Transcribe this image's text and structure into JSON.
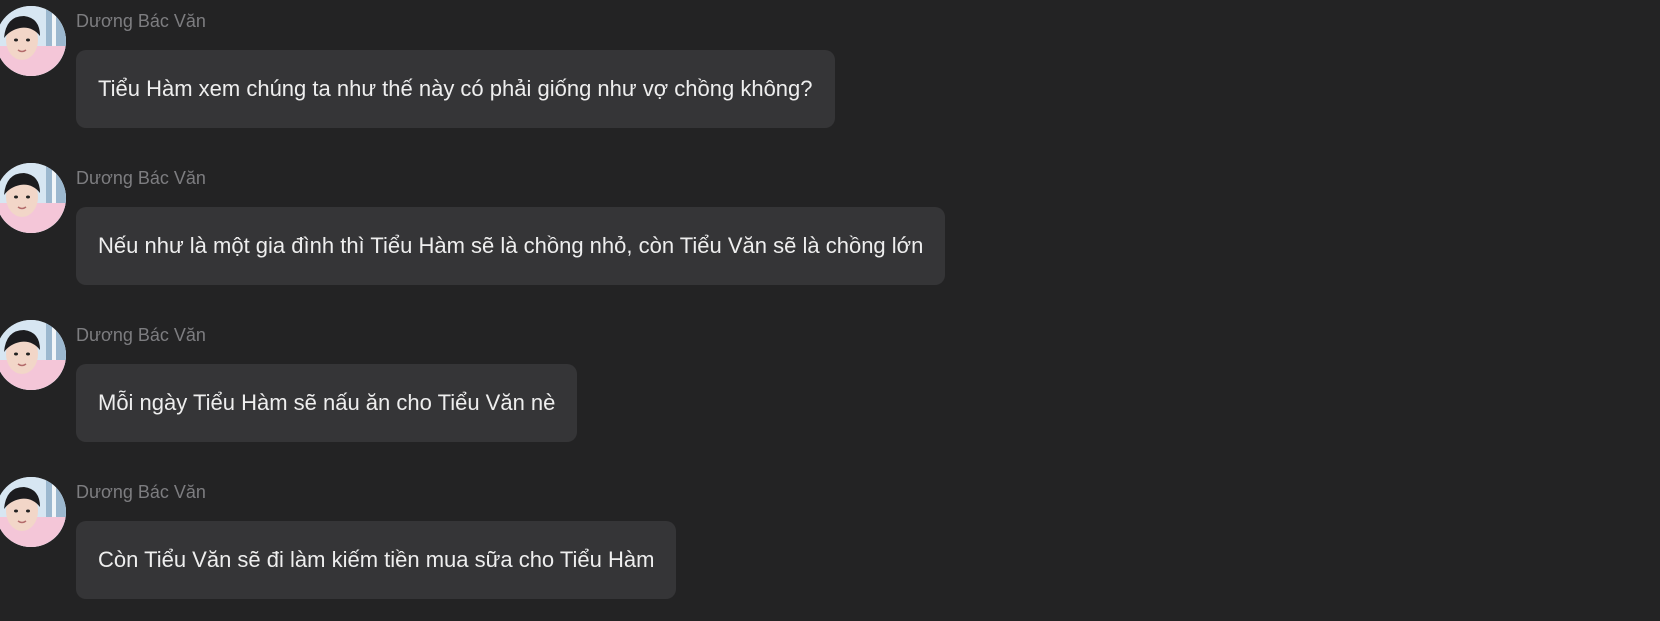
{
  "messages": [
    {
      "sender": "Dương Bác Văn",
      "text": "Tiểu Hàm xem chúng ta như thế này có phải giống như vợ chồng không?"
    },
    {
      "sender": "Dương Bác Văn",
      "text": "Nếu như là một gia đình thì Tiểu Hàm sẽ là chồng nhỏ, còn Tiểu Văn sẽ là chồng lớn"
    },
    {
      "sender": "Dương Bác Văn",
      "text": "Mỗi ngày Tiểu Hàm sẽ nấu ăn cho Tiểu Văn nè"
    },
    {
      "sender": "Dương Bác Văn",
      "text": "Còn Tiểu Văn sẽ đi làm kiếm tiền mua sữa cho Tiểu Hàm"
    }
  ],
  "colors": {
    "background": "#232324",
    "bubble": "#353537",
    "message_text": "#eeeeee",
    "sender_text": "#7d7d80"
  }
}
